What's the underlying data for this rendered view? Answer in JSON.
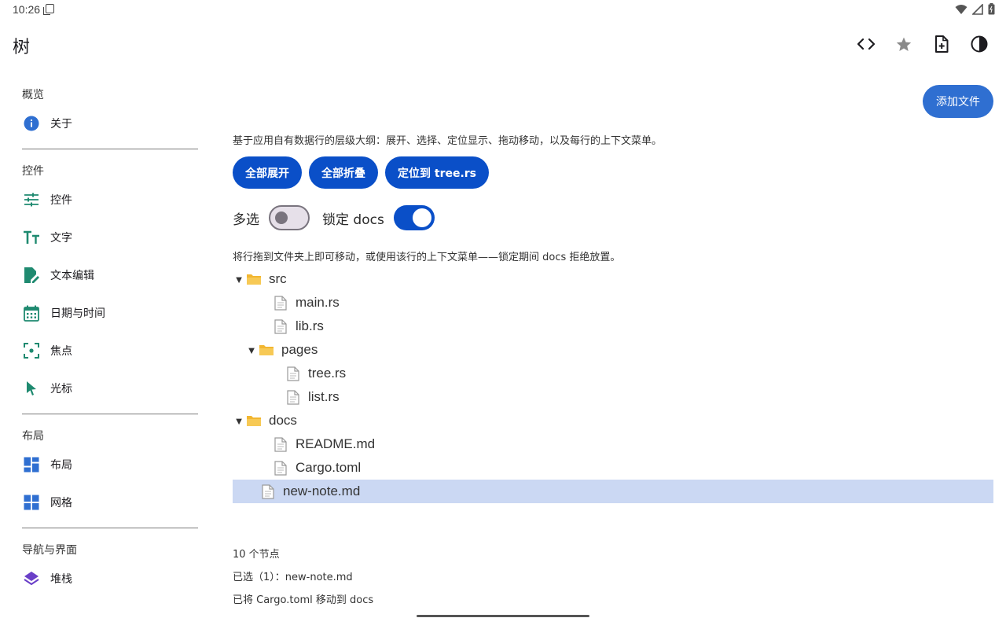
{
  "status": {
    "time": "10:26"
  },
  "appbar": {
    "title": "树",
    "actions": [
      "code-icon",
      "star-icon",
      "new-file-icon",
      "contrast-icon"
    ]
  },
  "sidebar": {
    "sections": [
      {
        "title": "概览",
        "items": [
          {
            "label": "关于",
            "icon": "info-icon"
          }
        ]
      },
      {
        "title": "控件",
        "items": [
          {
            "label": "控件",
            "icon": "tune-icon"
          },
          {
            "label": "文字",
            "icon": "text-icon"
          },
          {
            "label": "文本编辑",
            "icon": "edit-document-icon"
          },
          {
            "label": "日期与时间",
            "icon": "calendar-icon"
          },
          {
            "label": "焦点",
            "icon": "focus-icon"
          },
          {
            "label": "光标",
            "icon": "cursor-icon"
          }
        ]
      },
      {
        "title": "布局",
        "items": [
          {
            "label": "布局",
            "icon": "dashboard-icon"
          },
          {
            "label": "网格",
            "icon": "grid-icon"
          }
        ]
      },
      {
        "title": "导航与界面",
        "items": [
          {
            "label": "堆栈",
            "icon": "stack-icon"
          }
        ]
      }
    ]
  },
  "main": {
    "add_file": "添加文件",
    "description": "基于应用自有数据行的层级大纲：展开、选择、定位显示、拖动移动，以及每行的上下文菜单。",
    "buttons": {
      "expand_all": "全部展开",
      "collapse_all": "全部折叠",
      "reveal": "定位到 tree.rs"
    },
    "toggles": {
      "multi_select": "多选",
      "multi_select_on": false,
      "lock_docs": "锁定 docs",
      "lock_docs_on": true
    },
    "hint": "将行拖到文件夹上即可移动，或使用该行的上下文菜单——锁定期间 docs 拒绝放置。",
    "tree": [
      {
        "label": "src",
        "type": "folder",
        "depth": 0,
        "expanded": true,
        "selected": false
      },
      {
        "label": "main.rs",
        "type": "file",
        "depth": 1,
        "selected": false
      },
      {
        "label": "lib.rs",
        "type": "file",
        "depth": 1,
        "selected": false
      },
      {
        "label": "pages",
        "type": "folder",
        "depth": 1,
        "expanded": true,
        "selected": false
      },
      {
        "label": "tree.rs",
        "type": "file",
        "depth": 2,
        "selected": false
      },
      {
        "label": "list.rs",
        "type": "file",
        "depth": 2,
        "selected": false
      },
      {
        "label": "docs",
        "type": "folder",
        "depth": 0,
        "expanded": true,
        "selected": false
      },
      {
        "label": "README.md",
        "type": "file",
        "depth": 1,
        "selected": false
      },
      {
        "label": "Cargo.toml",
        "type": "file",
        "depth": 1,
        "selected": false
      },
      {
        "label": "new-note.md",
        "type": "file",
        "depth": 0,
        "selected": true
      }
    ],
    "node_count": "10 个节点",
    "selection": "已选（1）：new-note.md",
    "last_action": "已将 Cargo.toml 移动到 docs"
  },
  "colors": {
    "primary": "#0a4fc8",
    "add_button": "#2f6fd1",
    "selection": "#cbd8f3",
    "nav_icon": "#1f8a70",
    "folder": "#f2b630"
  }
}
